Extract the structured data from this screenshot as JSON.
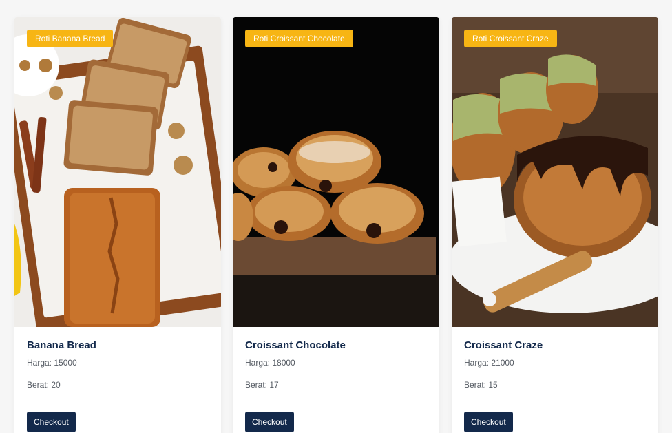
{
  "products": [
    {
      "badge": "Roti Banana Bread",
      "name": "Banana Bread",
      "price_label": "Harga: 15000",
      "weight_label": "Berat: 20",
      "button_label": "Checkout"
    },
    {
      "badge": "Roti Croissant Chocolate",
      "name": "Croissant Chocolate",
      "price_label": "Harga: 18000",
      "weight_label": "Berat: 17",
      "button_label": "Checkout"
    },
    {
      "badge": "Roti Croissant Craze",
      "name": "Croissant Craze",
      "price_label": "Harga: 21000",
      "weight_label": "Berat: 15",
      "button_label": "Checkout"
    }
  ],
  "colors": {
    "badge": "#f7b514",
    "title": "#13294b",
    "button": "#13294b",
    "text": "#555b63"
  }
}
